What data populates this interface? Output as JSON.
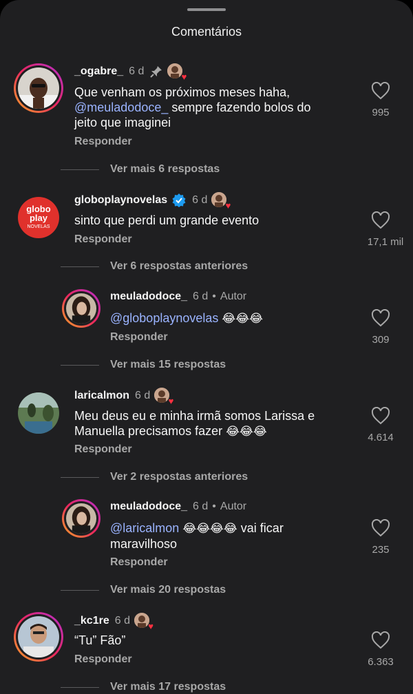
{
  "header": {
    "title": "Comentários"
  },
  "comments": [
    {
      "username": "_ogabre_",
      "time": "6 d",
      "text_parts": [
        "Que venham os próximos meses haha,",
        "@meuladodoce_",
        " sempre fazendo bolos do",
        "jeito que imaginei"
      ],
      "reply": "Responder",
      "likes": "995",
      "more": "Ver mais 6 respostas"
    },
    {
      "username": "globoplaynovelas",
      "logo": [
        "globo",
        "play",
        "NOVELAS"
      ],
      "time": "6 d",
      "text": "sinto que perdi um grande evento",
      "reply": "Responder",
      "likes": "17,1 mil",
      "more": "Ver 6 respostas anteriores"
    },
    {
      "username": "meuladodoce_",
      "time": "6 d",
      "author": "Autor",
      "mention": "@globoplaynovelas",
      "emojis": "😂😂😂",
      "reply": "Responder",
      "likes": "309",
      "more": "Ver mais 15 respostas"
    },
    {
      "username": "laricalmon",
      "time": "6 d",
      "line1": "Meu deus eu e minha irmã somos Larissa e",
      "line2": "Manuella precisamos fazer",
      "emojis": "😂😂😂",
      "reply": "Responder",
      "likes": "4.614",
      "more": "Ver 2 respostas anteriores"
    },
    {
      "username": "meuladodoce_",
      "time": "6 d",
      "author": "Autor",
      "mention": "@laricalmon",
      "emojis": "😂😂😂😂",
      "after": " vai ficar",
      "line2": "maravilhoso",
      "reply": "Responder",
      "likes": "235",
      "more": "Ver mais 20 respostas"
    },
    {
      "username": "_kc1re",
      "time": "6 d",
      "text": "“Tu” Fão”",
      "reply": "Responder",
      "likes": "6.363",
      "more": "Ver mais 17 respostas"
    }
  ],
  "icons": {
    "heart_outline": "heart-outline-icon",
    "pin": "pin-icon",
    "verified": "verified-badge-icon",
    "liked_by_author": "liked-by-author-icon"
  },
  "colors": {
    "background": "#1f1f21",
    "mention": "#9ab3ff",
    "muted": "#a8a8a8",
    "verified": "#1d9bf0",
    "globo_red": "#e0312c"
  }
}
